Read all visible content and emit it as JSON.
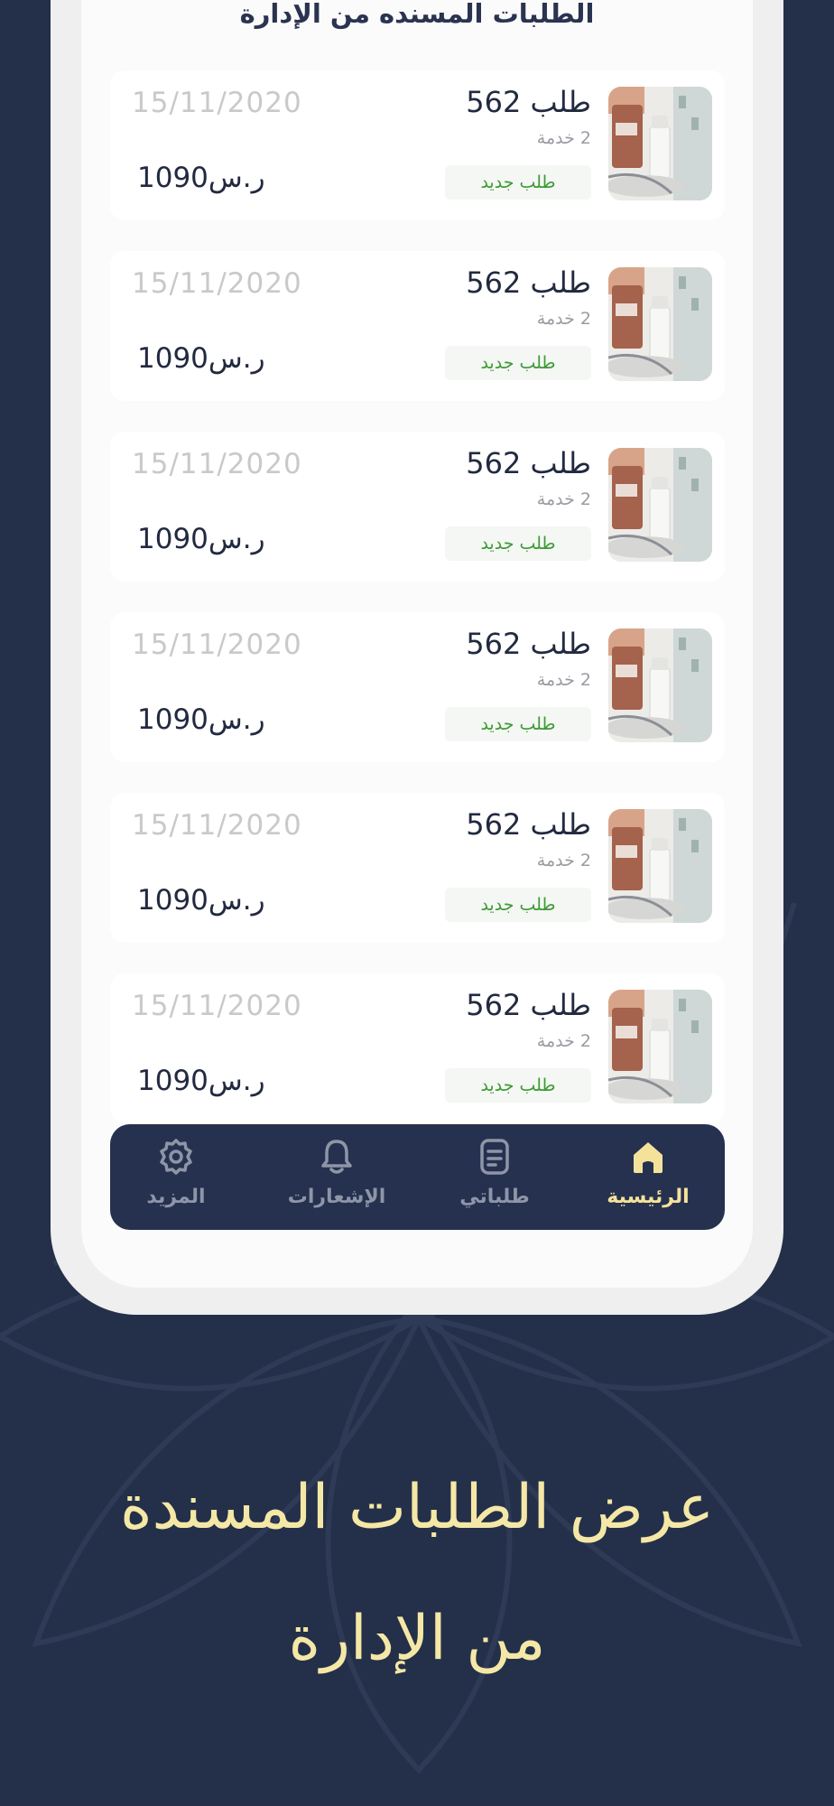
{
  "screen": {
    "title": "الطلبات المسنده من الإدارة"
  },
  "orders": [
    {
      "title": "طلب 562",
      "services": "2 خدمة",
      "status": "طلب جديد",
      "date": "15/11/2020",
      "price": "1090ر.س"
    },
    {
      "title": "طلب 562",
      "services": "2 خدمة",
      "status": "طلب جديد",
      "date": "15/11/2020",
      "price": "1090ر.س"
    },
    {
      "title": "طلب 562",
      "services": "2 خدمة",
      "status": "طلب جديد",
      "date": "15/11/2020",
      "price": "1090ر.س"
    },
    {
      "title": "طلب 562",
      "services": "2 خدمة",
      "status": "طلب جديد",
      "date": "15/11/2020",
      "price": "1090ر.س"
    },
    {
      "title": "طلب 562",
      "services": "2 خدمة",
      "status": "طلب جديد",
      "date": "15/11/2020",
      "price": "1090ر.س"
    },
    {
      "title": "طلب 562",
      "services": "2 خدمة",
      "status": "طلب جديد",
      "date": "15/11/2020",
      "price": "1090ر.س"
    }
  ],
  "nav": {
    "items": [
      {
        "label": "الرئيسية",
        "icon": "home-icon",
        "active": true
      },
      {
        "label": "طلباتي",
        "icon": "orders-icon",
        "active": false
      },
      {
        "label": "الإشعارات",
        "icon": "bell-icon",
        "active": false
      },
      {
        "label": "المزيد",
        "icon": "gear-icon",
        "active": false
      }
    ]
  },
  "caption": {
    "line1": "عرض الطلبات المسندة",
    "line2": "من الإدارة"
  },
  "colors": {
    "background": "#243049",
    "nav_background": "#263150",
    "accent_yellow": "#f5e29a",
    "status_green": "#3e9a36",
    "text_dark": "#222a40"
  }
}
